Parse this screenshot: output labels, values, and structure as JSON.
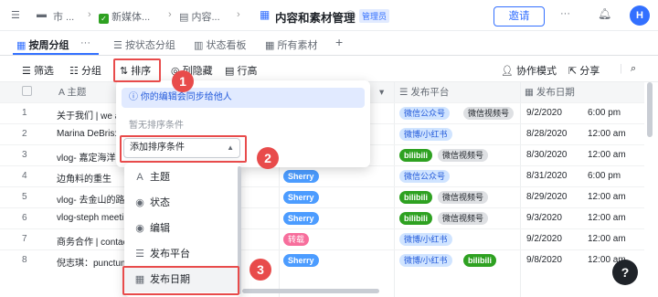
{
  "topbar": {
    "crumb1": "市 ...",
    "crumb2": "新媒体...",
    "crumb3": "内容...",
    "title": "内容和素材管理",
    "badge": "管理员",
    "invite": "邀请",
    "avatar": "H"
  },
  "tabs": [
    {
      "label": "按周分组",
      "active": true
    },
    {
      "label": "按状态分组"
    },
    {
      "label": "状态看板"
    },
    {
      "label": "所有素材"
    }
  ],
  "toolbar": {
    "filter": "筛选",
    "group": "分组",
    "sort": "排序",
    "hide": "列隐藏",
    "rowheight": "行高",
    "collab": "协作模式",
    "share": "分享"
  },
  "columns": {
    "title": "主题",
    "platform": "发布平台",
    "date": "发布日期"
  },
  "rows": [
    {
      "n": "1",
      "title": "关于我们 | we a",
      "editor": "",
      "platforms": [
        [
          "微信公众号",
          "wx"
        ],
        [
          "微信视频号",
          "wv"
        ]
      ],
      "date": "9/2/2020",
      "time": "6:00 pm"
    },
    {
      "n": "2",
      "title": "Marina DeBris:",
      "editor": "",
      "platforms": [
        [
          "微博/小红书",
          "xhs"
        ]
      ],
      "date": "8/28/2020",
      "time": "12:00 am"
    },
    {
      "n": "3",
      "title": "vlog- 嘉定海洋",
      "editor": "",
      "platforms": [
        [
          "bilibili",
          "bl"
        ],
        [
          "微信视频号",
          "wv"
        ]
      ],
      "date": "8/30/2020",
      "time": "12:00 am"
    },
    {
      "n": "4",
      "title": "边角料的重生",
      "editor": "Sherry",
      "platforms": [
        [
          "微信公众号",
          "wx"
        ]
      ],
      "date": "8/31/2020",
      "time": "6:00 pm"
    },
    {
      "n": "5",
      "title": "vlog- 去金山的路上",
      "editor": "Sherry",
      "platforms": [
        [
          "bilibili",
          "bl"
        ],
        [
          "微信视频号",
          "wv"
        ]
      ],
      "date": "8/29/2020",
      "time": "12:00 am"
    },
    {
      "n": "6",
      "title": "vlog-steph meeti",
      "editor": "Sherry",
      "platforms": [
        [
          "bilibili",
          "bl"
        ],
        [
          "微信视频号",
          "wv"
        ]
      ],
      "date": "9/3/2020",
      "time": "12:00 am"
    },
    {
      "n": "7",
      "title": "商务合作 | contac",
      "editor": "转载",
      "platforms": [
        [
          "微博/小红书",
          "xhs"
        ]
      ],
      "date": "9/2/2020",
      "time": "12:00 am"
    },
    {
      "n": "8",
      "title": "倪志琪：punctum",
      "editor": "Sherry",
      "platforms": [
        [
          "微博/小红书",
          "xhs"
        ],
        [
          "bilibili",
          "bl"
        ]
      ],
      "date": "9/8/2020",
      "time": "12:00 am"
    }
  ],
  "sort_popup": {
    "notice": "你的编辑会同步给他人",
    "empty": "暂无排序条件",
    "add": "添加排序条件"
  },
  "field_menu": [
    {
      "label": "主题",
      "icon": "A"
    },
    {
      "label": "状态",
      "icon": "◉"
    },
    {
      "label": "编辑",
      "icon": "◉"
    },
    {
      "label": "发布平台",
      "icon": "☰"
    },
    {
      "label": "发布日期",
      "icon": "▦"
    }
  ],
  "callouts": [
    "1",
    "2",
    "3"
  ],
  "help": "?"
}
